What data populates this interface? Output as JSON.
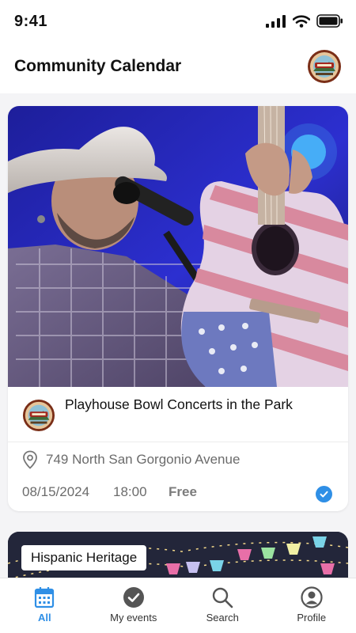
{
  "status_bar": {
    "time": "9:41"
  },
  "header": {
    "title": "Community Calendar",
    "avatar_icon": "city-seal-icon"
  },
  "event_card": {
    "org_logo_icon": "city-seal-icon",
    "title": "Playhouse Bowl Concerts in the Park",
    "location_icon": "map-pin-icon",
    "location": "749 North San Gorgonio Avenue",
    "date": "08/15/2024",
    "time": "18:00",
    "price": "Free",
    "attending_icon": "check-circle-icon"
  },
  "next_card": {
    "tag": "Hispanic Heritage"
  },
  "nav": {
    "items": [
      {
        "label": "All",
        "icon": "calendar-icon",
        "active": true
      },
      {
        "label": "My events",
        "icon": "check-circle-icon",
        "active": false
      },
      {
        "label": "Search",
        "icon": "search-icon",
        "active": false
      },
      {
        "label": "Profile",
        "icon": "profile-icon",
        "active": false
      }
    ]
  },
  "colors": {
    "accent": "#2f8fe6",
    "text": "#111111",
    "muted": "#6b6b6b",
    "background": "#f4f4f6"
  }
}
